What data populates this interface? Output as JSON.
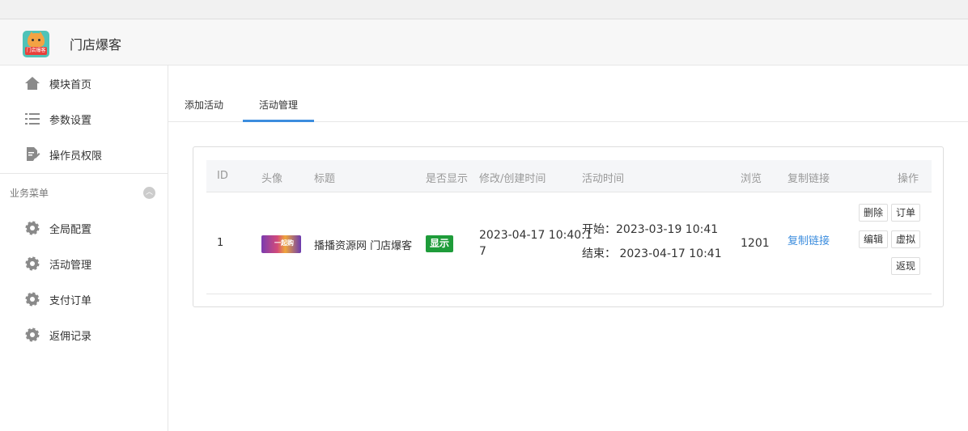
{
  "app": {
    "title": "门店爆客",
    "logo_text": "门店爆客"
  },
  "sidebar": {
    "top_items": [
      {
        "label": "模块首页",
        "icon": "home-icon"
      },
      {
        "label": "参数设置",
        "icon": "list-icon"
      },
      {
        "label": "操作员权限",
        "icon": "document-edit-icon"
      }
    ],
    "group_title": "业务菜单",
    "group_items": [
      {
        "label": "全局配置",
        "icon": "gear-icon"
      },
      {
        "label": "活动管理",
        "icon": "gear-icon"
      },
      {
        "label": "支付订单",
        "icon": "gear-icon"
      },
      {
        "label": "返佣记录",
        "icon": "gear-icon"
      }
    ]
  },
  "tabs": [
    {
      "label": "添加活动",
      "active": false
    },
    {
      "label": "活动管理",
      "active": true
    }
  ],
  "table": {
    "headers": [
      "ID",
      "头像",
      "标题",
      "是否显示",
      "修改/创建时间",
      "活动时间",
      "浏览",
      "复制链接",
      "操作"
    ],
    "rows": [
      {
        "id": "1",
        "thumb_text": "一起购",
        "title": "播播资源网 门店爆客",
        "visible": "显示",
        "modified_line1": "2023-04-17 10:40:1",
        "modified_line2": "7",
        "start": "开始：2023-03-19 10:41",
        "end": "结束： 2023-04-17 10:41",
        "views": "1201",
        "copy_link": "复制链接",
        "actions": {
          "delete": "删除",
          "orders": "订单",
          "edit": "编辑",
          "virtual": "虚拟",
          "rebate": "返现"
        }
      }
    ]
  },
  "colors": {
    "accent": "#3c8dde",
    "badge": "#1e9c3a",
    "logo_bg": "#4fc3b8"
  }
}
